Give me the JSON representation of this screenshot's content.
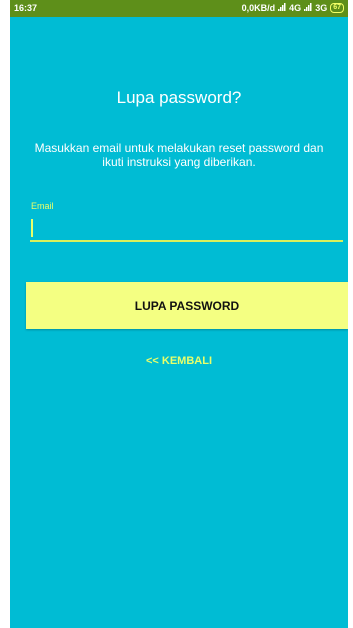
{
  "status_bar": {
    "time": "16:37",
    "network_speed": "0,0KB/d",
    "signal_1": "4G",
    "signal_2": "3G",
    "battery": "67"
  },
  "page": {
    "title": "Lupa password?",
    "instruction": "Masukkan email untuk melakukan reset password dan ikuti instruksi yang diberikan."
  },
  "form": {
    "email_label": "Email",
    "email_value": "",
    "submit_label": "LUPA PASSWORD",
    "back_label": "<< KEMBALI"
  },
  "colors": {
    "background": "#00bcd4",
    "status_bar": "#5e8f1a",
    "button": "#f4ff82",
    "accent": "#e8ff6a"
  }
}
